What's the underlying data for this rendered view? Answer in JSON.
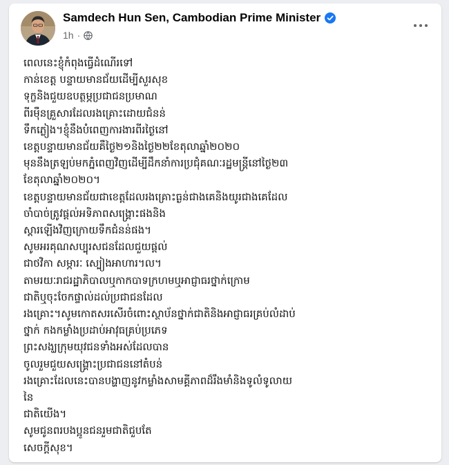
{
  "post": {
    "author": "Samdech Hun Sen, Cambodian Prime Minister",
    "time": "1h",
    "separator": "·",
    "more_icon": "more-horizontal-icon",
    "verified_icon": "verified-badge-icon",
    "privacy_icon": "globe-icon",
    "colors": {
      "verified": "#1877f2",
      "meta": "#65676b",
      "text": "#050505"
    },
    "lines": [
      "ពេលនេះខ្ញុំកំពុងធ្វើដំណើរទៅ",
      "កាន់ខេត្ត បន្ទាយមានជ័យដើម្បីសួរសុខ",
      "ទុក្ខនិងជួយឧបត្ថម្ភប្រជាជនប្រមាណ",
      "ពីរម៉ឺនគ្រួសារដែលរងគ្រោះដោយជំនន់",
      "ទឹកភ្លៀង។ខ្ញុំនឹងបំពេញការងារពីរថ្ងៃនៅ",
      "ខេត្តបន្ទាយមានជ័យគឺថ្ងៃ២១និងថ្ងៃ២២ខែតុលាឆ្នាំ២០២០",
      "មុននឹងត្រឡប់មកភ្នំពេញវិញដើម្បីដឹកនាំការប្រជុំគណៈរដ្ឋមន្ត្រីនៅថ្ងៃ២៣",
      "ខែតុលាឆ្នាំ២០២០។",
      "ខេត្តបន្ទាយមានជ័យជាខេត្តដែលរងគ្រោះធ្ងន់ជាងគេនិងយូរជាងគេដែល",
      "ចាំបាច់ត្រូវផ្តល់អទិភាពសង្គ្រោះផងនិង",
      "ស្តារឡើងវិញក្រោយទឹកជំនន់ផង។",
      "សូមអរគុណសប្បុរសជនដែលជួយផ្តល់",
      "ជាថវិកា សម្ភារៈ ស្បៀងអាហារ។ល។",
      "តាមរយៈរាជរដ្ឋាភិបាលឬកាកបាទក្រហមឬអាជ្ញាធរថ្នាក់ក្រោម",
      "ជាតិឬចុះចែកផ្ទាល់ដល់ប្រជាជនដែល",
      "រងគ្រោះ។សូមកោតសរសើរចំពោះស្ថាប័នថ្នាក់ជាតិនិងអាជ្ញាធរគ្រប់លំដាប់",
      "ថ្នាក់ កងកម្លាំងប្រដាប់អាវុធគ្រប់ប្រភេទ",
      "ព្រះសង្ឃក្រុមយុវជនទាំងអស់ដែលបាន",
      "ចូលរួមជួយសង្គ្រោះប្រជាជននៅតំបន់",
      "រងគ្រោះដែលនេះបានបង្ហាញនូវកម្លាំងសាមគ្គីភាពដ៏រឹងមាំនិងទូលំទូលាយ",
      "នៃ",
      "ជាតិយើង។",
      "សូមជូនពរបងប្អូនជនរួមជាតិជួបតែ",
      "សេចក្តីសុខ។"
    ]
  }
}
